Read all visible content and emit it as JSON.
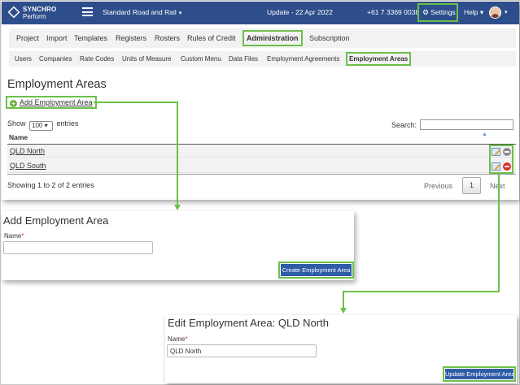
{
  "topbar": {
    "logo_line1": "SYNCHRO",
    "logo_line2": "Perform",
    "company": "Standard Road and Rail",
    "update": "Update - 22 Apr 2022",
    "phone": "+61 7 3369 0038",
    "settings_label": "Settings",
    "help_label": "Help"
  },
  "nav_primary": [
    "Project",
    "Import",
    "Templates",
    "Registers",
    "Rosters",
    "Rules of Credit",
    "Administration",
    "Subscription"
  ],
  "nav_secondary": [
    "Users",
    "Companies",
    "Rate Codes",
    "Units of Measure",
    "Custom Menu",
    "Data Files",
    "Employment Agreements",
    "Employment Areas"
  ],
  "page": {
    "title": "Employment Areas",
    "add_link": "Add Employment Area",
    "show_label": "Show",
    "entries_value": "100",
    "entries_label": "entries",
    "search_label": "Search:",
    "column_name": "Name",
    "rows": [
      {
        "name": "QLD North"
      },
      {
        "name": "QLD South"
      }
    ],
    "showing": "Showing 1 to 2 of 2 entries",
    "previous": "Previous",
    "current_page": "1",
    "next": "Next"
  },
  "add_form": {
    "title": "Add Employment Area",
    "name_label": "Name",
    "required_marker": "*",
    "name_value": "",
    "button": "Create Employment Area"
  },
  "edit_form": {
    "title": "Edit Employment Area: QLD North",
    "name_label": "Name",
    "required_marker": "*",
    "name_value": "QLD North",
    "button": "Update Employment Area"
  },
  "colors": {
    "header_blue": "#2d4e8a",
    "highlight_green": "#6cc04a",
    "button_blue": "#2f5ca6",
    "delete_red": "#d9302b"
  },
  "icons": [
    "hamburger-icon",
    "gear-icon",
    "add-circle-icon",
    "sort-icon",
    "edit-icon",
    "delete-icon",
    "avatar"
  ]
}
